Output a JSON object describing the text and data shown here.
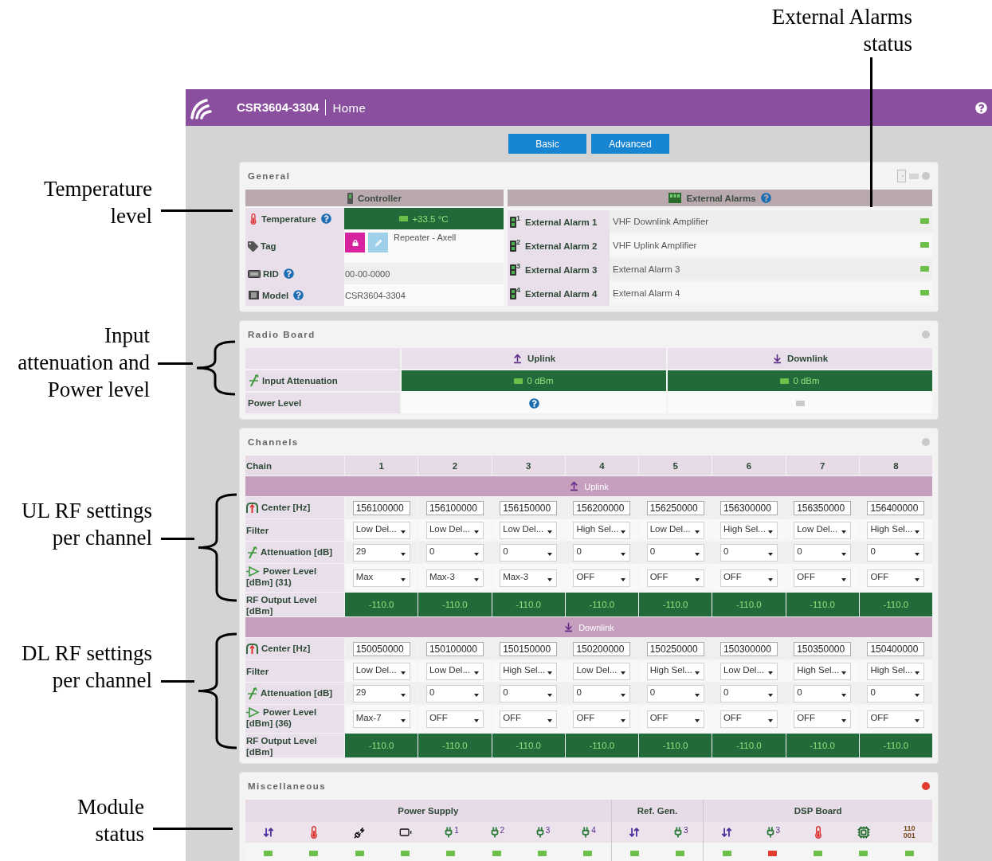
{
  "annotations": [
    {
      "kind": "line",
      "lines": [
        "External Alarms",
        "status"
      ]
    },
    {
      "kind": "line",
      "lines": [
        "Temperature",
        "level"
      ]
    },
    {
      "kind": "brace",
      "lines": [
        "Input",
        "attenuation and",
        "Power level"
      ]
    },
    {
      "kind": "brace",
      "lines": [
        "UL RF settings",
        "per channel"
      ]
    },
    {
      "kind": "brace",
      "lines": [
        "DL RF settings",
        "per channel"
      ]
    },
    {
      "kind": "line",
      "lines": [
        "Module",
        "status"
      ]
    }
  ],
  "header": {
    "device": "CSR3604-3304",
    "page": "Home"
  },
  "view_buttons": [
    "Basic",
    "Advanced"
  ],
  "general": {
    "title": "General",
    "color": "#c9c9c9",
    "controller": {
      "title": "Controller",
      "rows": [
        {
          "kind": "temperature",
          "label": "Temperature",
          "help": true,
          "value": "+33.5 °C",
          "color": "#6cc04a"
        },
        {
          "kind": "tag",
          "label": "Tag",
          "help": false,
          "value": "Repeater - Axell"
        },
        {
          "kind": "rid",
          "label": "RID",
          "help": true,
          "value": "00-00-0000"
        },
        {
          "kind": "model",
          "label": "Model",
          "help": true,
          "value": "CSR3604-3304"
        }
      ]
    },
    "external_alarms": {
      "title": "External Alarms",
      "help": true,
      "rows": [
        {
          "number": "1",
          "label": "External Alarm 1",
          "value": "VHF Downlink Amplifier",
          "color": "#6cc04a"
        },
        {
          "number": "2",
          "label": "External Alarm 2",
          "value": "VHF Uplink Amplifier",
          "color": "#6cc04a"
        },
        {
          "number": "3",
          "label": "External Alarm 3",
          "value": "External Alarm 3",
          "color": "#6cc04a"
        },
        {
          "number": "4",
          "label": "External Alarm 4",
          "value": "External Alarm 4",
          "color": "#6cc04a"
        }
      ]
    }
  },
  "radio_board": {
    "title": "Radio Board",
    "color": "#c9c9c9",
    "columns": [
      {
        "kind": "up",
        "label": "Uplink"
      },
      {
        "kind": "down",
        "label": "Downlink"
      }
    ],
    "input_attenuation": {
      "label": "Input Attenuation",
      "values": [
        {
          "value": "0 dBm",
          "color": "#6cc04a"
        },
        {
          "value": "0 dBm",
          "color": "#6cc04a"
        }
      ]
    },
    "power_level": {
      "label": "Power Level",
      "cells": [
        {
          "kind": "help"
        },
        {
          "kind": "led",
          "color": "#c9c9c9"
        }
      ]
    }
  },
  "channels": {
    "title": "Channels",
    "color": "#c9c9c9",
    "chain_label": "Chain",
    "chains": [
      "1",
      "2",
      "3",
      "4",
      "5",
      "6",
      "7",
      "8"
    ],
    "sections": [
      {
        "kind": "up",
        "label": "Uplink",
        "rows": [
          {
            "kind": "input",
            "label": "Center [Hz]",
            "values": [
              "156100000",
              "156100000",
              "156150000",
              "156200000",
              "156250000",
              "156300000",
              "156350000",
              "156400000"
            ]
          },
          {
            "kind": "select",
            "label": "Filter",
            "values": [
              "Low Del...",
              "Low Del...",
              "Low Del...",
              "High Sel...",
              "Low Del...",
              "High Sel...",
              "Low Del...",
              "High Sel..."
            ]
          },
          {
            "kind": "select",
            "label": "Attenuation [dB]",
            "values": [
              "29",
              "0",
              "0",
              "0",
              "0",
              "0",
              "0",
              "0"
            ]
          },
          {
            "kind": "select",
            "label": "Power Level [dBm] (31)",
            "values": [
              "Max",
              "Max-3",
              "Max-3",
              "OFF",
              "OFF",
              "OFF",
              "OFF",
              "OFF"
            ]
          },
          {
            "kind": "readout",
            "label": "RF Output Level [dBm]",
            "values": [
              "-110.0",
              "-110.0",
              "-110.0",
              "-110.0",
              "-110.0",
              "-110.0",
              "-110.0",
              "-110.0"
            ]
          }
        ]
      },
      {
        "kind": "down",
        "label": "Downlink",
        "rows": [
          {
            "kind": "input",
            "label": "Center [Hz]",
            "values": [
              "150050000",
              "150100000",
              "150150000",
              "150200000",
              "150250000",
              "150300000",
              "150350000",
              "150400000"
            ]
          },
          {
            "kind": "select",
            "label": "Filter",
            "values": [
              "Low Del...",
              "Low Del...",
              "High Sel...",
              "Low Del...",
              "High Sel...",
              "Low Del...",
              "High Sel...",
              "High Sel..."
            ]
          },
          {
            "kind": "select",
            "label": "Attenuation [dB]",
            "values": [
              "29",
              "0",
              "0",
              "0",
              "0",
              "0",
              "0",
              "0"
            ]
          },
          {
            "kind": "select",
            "label": "Power Level [dBm] (36)",
            "values": [
              "Max-7",
              "OFF",
              "OFF",
              "OFF",
              "OFF",
              "OFF",
              "OFF",
              "OFF"
            ]
          },
          {
            "kind": "readout",
            "label": "RF Output Level [dBm]",
            "values": [
              "-110.0",
              "-110.0",
              "-110.0",
              "-110.0",
              "-110.0",
              "-110.0",
              "-110.0",
              "-110.0"
            ]
          }
        ]
      }
    ]
  },
  "miscellaneous": {
    "title": "Miscellaneous",
    "color": "#e23b2e",
    "groups": [
      {
        "label": "Power Supply",
        "items": [
          {
            "kind": "updown",
            "color": "#6cc04a"
          },
          {
            "kind": "thermometer",
            "color": "#6cc04a"
          },
          {
            "kind": "plug-arrow",
            "color": "#6cc04a"
          },
          {
            "kind": "battery",
            "color": "#6cc04a"
          },
          {
            "kind": "plug",
            "number": "1",
            "color": "#6cc04a"
          },
          {
            "kind": "plug",
            "number": "2",
            "color": "#6cc04a"
          },
          {
            "kind": "plug",
            "number": "3",
            "color": "#6cc04a"
          },
          {
            "kind": "plug",
            "number": "4",
            "color": "#6cc04a"
          }
        ]
      },
      {
        "label": "Ref. Gen.",
        "items": [
          {
            "kind": "updown",
            "color": "#6cc04a"
          },
          {
            "kind": "plug",
            "number": "3",
            "color": "#6cc04a"
          }
        ]
      },
      {
        "label": "DSP Board",
        "items": [
          {
            "kind": "updown",
            "color": "#6cc04a"
          },
          {
            "kind": "plug",
            "number": "3",
            "color": "#e23b2e"
          },
          {
            "kind": "thermometer",
            "color": "#6cc04a"
          },
          {
            "kind": "chip",
            "color": "#6cc04a"
          },
          {
            "kind": "binary",
            "text": "110 001",
            "color": "#6cc04a"
          }
        ]
      }
    ]
  }
}
